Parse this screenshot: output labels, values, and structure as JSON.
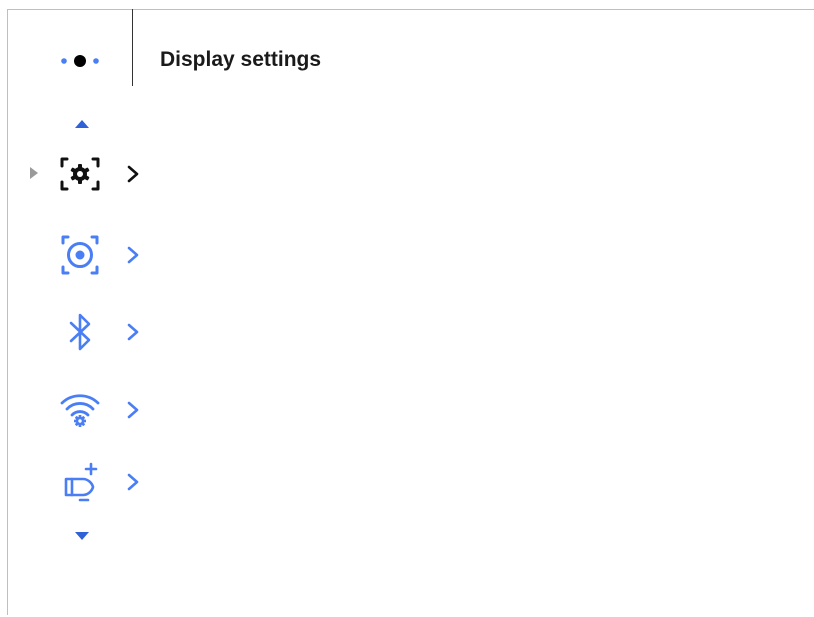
{
  "header": {
    "title": "Display settings"
  },
  "pager": {
    "pages": 3,
    "current": 2
  },
  "menu": {
    "selected_index": 0,
    "items": [
      {
        "icon": "display-settings-icon",
        "selected": true
      },
      {
        "icon": "focus-target-icon",
        "selected": false
      },
      {
        "icon": "bluetooth-icon",
        "selected": false
      },
      {
        "icon": "wifi-settings-icon",
        "selected": false
      },
      {
        "icon": "ammo-add-icon",
        "selected": false
      }
    ]
  },
  "colors": {
    "accent": "#4a7ef5",
    "selected": "#111111",
    "title": "#1a1a1a",
    "frame": "#bfbfbf"
  }
}
